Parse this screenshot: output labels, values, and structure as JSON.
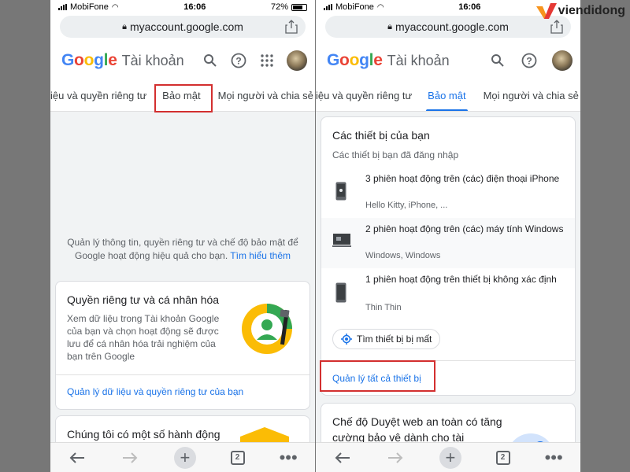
{
  "status": {
    "carrier": "MobiFone",
    "time": "16:06",
    "battery": "72%",
    "battery_level": 0.72
  },
  "browser": {
    "url": "myaccount.google.com",
    "lock_icon": "lock-icon",
    "share_icon": "share-icon"
  },
  "header": {
    "logo_letters": [
      "G",
      "o",
      "o",
      "g",
      "l",
      "e"
    ],
    "title": "Tài khoản",
    "icons": [
      "search-icon",
      "help-icon",
      "apps-grid-icon"
    ]
  },
  "tabs": [
    {
      "label": "iệu và quyền riêng tư"
    },
    {
      "label": "Bảo mật"
    },
    {
      "label": "Mọi người và chia sẻ"
    }
  ],
  "left": {
    "intro_text": "Quản lý thông tin, quyền riêng tư và chế độ bảo mật để Google hoạt động hiệu quả cho bạn.",
    "intro_link": "Tìm hiểu thêm",
    "privacy_card": {
      "title": "Quyền riêng tư và cá nhân hóa",
      "description": "Xem dữ liệu trong Tài khoản Google của bạn và chọn hoạt động sẽ được lưu để cá nhân hóa trải nghiệm của bạn trên Google",
      "link": "Quản lý dữ liệu và quyền riêng tư của bạn"
    },
    "action_card": {
      "title": "Chúng tôi có một số hành động"
    }
  },
  "right": {
    "devices_card": {
      "title": "Các thiết bị của bạn",
      "subtitle": "Các thiết bị bạn đã đăng nhập",
      "devices": [
        {
          "title": "3 phiên hoạt động trên (các) điện thoại iPhone",
          "sub": "Hello Kitty, iPhone, ...",
          "icon": "iphone-icon"
        },
        {
          "title": "2 phiên hoạt động trên (các) máy tính Windows",
          "sub": "Windows, Windows",
          "icon": "windows-laptop-icon"
        },
        {
          "title": "1 phiên hoạt động trên thiết bị không xác định",
          "sub": "Thin Thin",
          "icon": "unknown-device-icon"
        }
      ],
      "find_button": "Tìm thiết bị bị mất",
      "manage_link": "Quản lý tất cả thiết bị"
    },
    "safe_browsing_card": {
      "title": "Chế độ Duyệt web an toàn có tăng cường bảo vệ dành cho tài"
    }
  },
  "toolbar": {
    "tab_count": "2",
    "icons": [
      "back-icon",
      "forward-icon",
      "new-tab-icon",
      "tabs-icon",
      "more-icon"
    ]
  },
  "watermark": {
    "brand": "viendidong",
    "sub": ".com"
  },
  "colors": {
    "google_blue": "#4285f4",
    "google_red": "#ea4335",
    "google_yellow": "#fbbc05",
    "google_green": "#34a853",
    "link_blue": "#1a73e8",
    "highlight_red": "#d32f2f"
  }
}
